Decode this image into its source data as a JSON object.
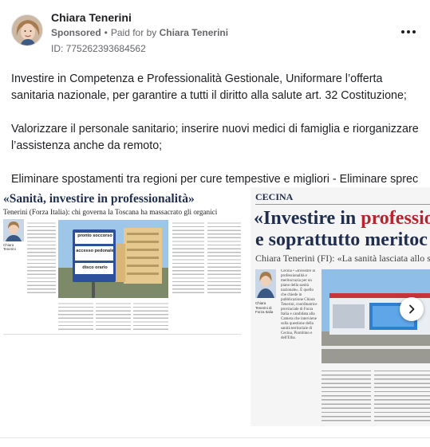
{
  "header": {
    "advertiser_name": "Chiara Tenerini",
    "sponsored_label": "Sponsored",
    "paid_for_prefix": "Paid for by",
    "paid_for_name": "Chiara Tenerini",
    "ad_id": "ID: 775262393684562",
    "more_icon": "more-horizontal-icon"
  },
  "body": {
    "paragraphs": [
      "Investire in Competenza e Professionalità Gestionale, Uniformare l’offerta sanitaria nazionale, per garantire a tutti il diritto alla salute art. 32 Costituzione;",
      "Valorizzare il personale sanitario; inserire nuovi medici di famiglia e riorganizzare l’assistenza anche da remoto;",
      "Eliminare spostamenti tra regioni per cure tempestive e migliori - Eliminare sprec…"
    ]
  },
  "carousel": {
    "slide1": {
      "headline": "«Sanità, investire in professionalità»",
      "subheadline": "Tenerini (Forza Italia): chi governa la Toscana ha massacrato gli organici",
      "photo_caption": "Chiara Tenerini",
      "sign_lines": [
        "pronto soccorso",
        "accesso pedonale",
        "disco orario"
      ]
    },
    "slide2": {
      "section": "CECINA",
      "headline_line1_a": "«Investire in ",
      "headline_line1_b": "professio",
      "headline_line2": "e soprattutto meritoc",
      "subheadline": "Chiara Tenerini (FI): «La sanità lasciata allo sb",
      "photo_caption": "Chiara Tenerini di Forza Italia",
      "article_lead": "Cecina • «Investire in professionalità e meritocrazia per un piano della sanità nazionale». È quello che chiede in pubblicazione Chiara Tenerini, coordinatrice provinciale di Forza Italia e candidata alla Camera che interviene sulla questione della sanità territoriale di Cecina, Piombino e dell'Elba."
    },
    "next_icon": "chevron-right-icon"
  },
  "colors": {
    "text_primary": "#1c1e21",
    "text_secondary": "#65676b",
    "headline_navy": "#1f2d4f",
    "headline_red": "#b3262e",
    "sign_blue": "#2d4f9c"
  }
}
